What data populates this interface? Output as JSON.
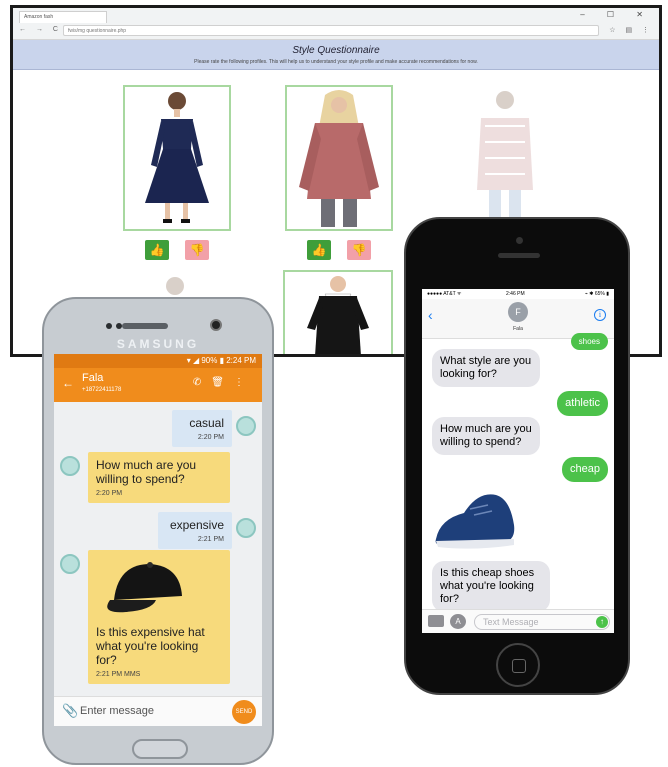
{
  "browser": {
    "tab_title": "Amazon fash",
    "url": "fwis/mg questionnaire.php",
    "window_controls": "– ☐ ✕",
    "nav": "← → C",
    "addr_icons": "☆ ▤ ⋮"
  },
  "questionnaire": {
    "title": "Style Questionnaire",
    "subtitle": "Please rate the following profiles. This will help us to understand your style profile and make accurate recommendations for now."
  },
  "samsung": {
    "brand": "SAMSUNG",
    "status_time": "▾ ◢ 90% ▮ 2:24 PM",
    "contact_name": "Fala",
    "contact_number": "+18722411178",
    "messages": [
      {
        "text": "casual",
        "time": "2:20 PM"
      },
      {
        "text": "How much are you willing to spend?",
        "time": "2:20 PM"
      },
      {
        "text": "expensive",
        "time": "2:21 PM"
      },
      {
        "text": "Is this expensive hat what you're looking for?",
        "time": "2:21 PM MMS"
      }
    ],
    "input_placeholder": "Enter message",
    "send_label": "SEND MMS"
  },
  "iphone": {
    "status_carrier": "●●●●● AT&T ᯤ",
    "status_time": "2:46 PM",
    "status_battery": "⌁ ✱ 65% ▮",
    "contact_name": "Fala",
    "contact_initial": "F",
    "top_partial": "shoes",
    "messages": [
      {
        "text": "What style are you looking for?"
      },
      {
        "text": "athletic"
      },
      {
        "text": "How much are you willing to spend?"
      },
      {
        "text": "cheap"
      },
      {
        "text": "Is this cheap shoes what you're looking for?"
      }
    ],
    "input_placeholder": "Text Message"
  },
  "colors": {
    "orange": "#f08c1c",
    "ios_green": "#4cc24a",
    "card_border": "#a8d8a0",
    "header_blue": "#c9d4ec"
  }
}
